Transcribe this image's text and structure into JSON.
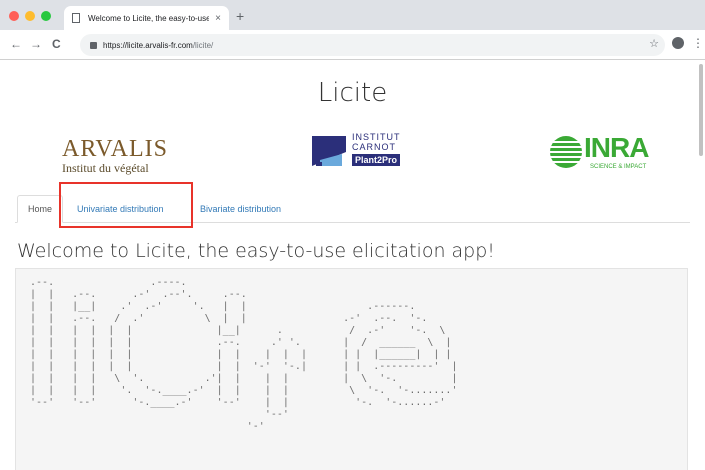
{
  "browser": {
    "tab_title": "Welcome to Licite, the easy-to-use elicitation app!",
    "tab_close": "×",
    "new_tab": "+",
    "back": "←",
    "forward": "→",
    "reload": "C",
    "url_host": "https://licite.arvalis-fr.com",
    "url_path": "/licite/",
    "star": "☆",
    "menu": "⋮",
    "traffic_light_colors": [
      "#ff5f57",
      "#febc2e",
      "#28c840"
    ]
  },
  "app": {
    "title": "Licite",
    "logos": {
      "arvalis_name": "ARVALIS",
      "arvalis_tagline": "Institut du végétal",
      "carnot_line1": "INSTITUT",
      "carnot_line2": "CARNOT",
      "carnot_line3": "Plant2Pro",
      "inra_name": "INRA",
      "inra_tagline": "SCIENCE & IMPACT"
    },
    "tabs": [
      {
        "label": "Home",
        "active": true
      },
      {
        "label": "Univariate distribution",
        "active": false
      },
      {
        "label": "Bivariate distribution",
        "active": false
      }
    ],
    "welcome_heading": "Welcome to Licite, the easy-to-use elicitation app!",
    "ascii_art": " .--.                .----.\n |  |   .--.      .-'  .--'.     .--.\n |  |   |__|    .'  .-'     '.   |  |                    .------.\n |  |   .--.   /  .'          \\  |  |                .-'  .--.  '-.\n |  |   |  |  |  |              |__|      .           /  .-'    '-.  \\\n |  |   |  |  |  |              .--.     .' '.       |  /  ______  \\  |\n |  |   |  |  |  |              |  |    |  |  |      | |  |______|  | |\n |  |   |  |  |  |              |  |  '-'  '-.|      | |  .---------'  |\n |  |   |  |   \\  '.          .'|  |    |  |         |  \\  '-.         |\n |  |   |  |    '.  '-.____.-'  |  |    |  |          \\  '-.  '-.......'\n '--'   '--'      '-.____.-'    '--'    |  |           '-.  '-......-'\n                                        '--'\n                                     '-'",
    "colors": {
      "arvalis_brown": "#7b5a2b",
      "carnot_navy": "#2b2f7a",
      "inra_green": "#3aa935",
      "link_blue": "#337ab7",
      "highlight_red": "#e8332a"
    }
  }
}
